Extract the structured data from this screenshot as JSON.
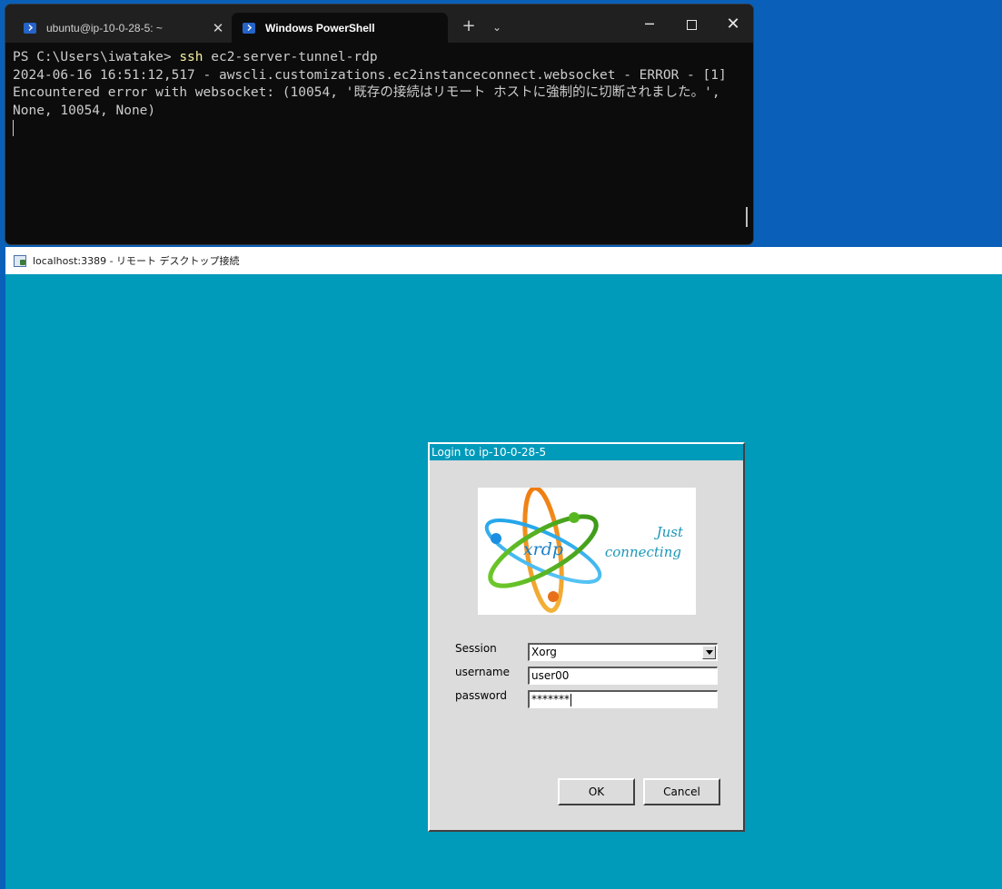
{
  "terminal": {
    "tabs": [
      {
        "label": "ubuntu@ip-10-0-28-5: ~",
        "close": "✕"
      },
      {
        "label": "Windows PowerShell"
      }
    ],
    "new_tab": "+",
    "dropdown": "⌄",
    "controls": {
      "minimize": "─",
      "close": "✕"
    },
    "prompt": "PS C:\\Users\\iwatake> ",
    "command": "ssh",
    "command_args": " ec2-server-tunnel-rdp",
    "output": "2024-06-16 16:51:12,517 - awscli.customizations.ec2instanceconnect.websocket - ERROR - [1] Encountered error with websocket: (10054, '既存の接続はリモート ホストに強制的に切断されました。', None, 10054, None)"
  },
  "rdp": {
    "title": "localhost:3389 - リモート デスクトップ接続",
    "background": "#009aba",
    "dialog": {
      "title": "Login to ip-10-0-28-5",
      "logo": {
        "brand": "xrdp",
        "tagline_1": "Just",
        "tagline_2": "connecting"
      },
      "session_label": "Session",
      "session_value": "Xorg",
      "username_label": "username",
      "username_value": "user00",
      "password_label": "password",
      "password_value": "*******",
      "ok_label": "OK",
      "cancel_label": "Cancel"
    }
  }
}
